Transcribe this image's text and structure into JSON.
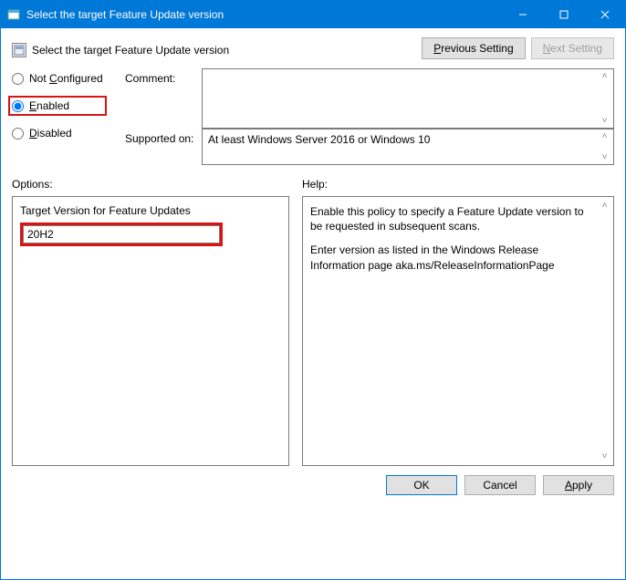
{
  "window": {
    "title": "Select the target Feature Update version"
  },
  "header": {
    "policy_name": "Select the target Feature Update version",
    "prev_label_pre": "P",
    "prev_label_post": "revious Setting",
    "next_label_pre": "N",
    "next_label_post": "ext Setting"
  },
  "radios": {
    "not_configured_pre": "Not ",
    "not_configured_u": "C",
    "not_configured_post": "onfigured",
    "enabled_u": "E",
    "enabled_post": "nabled",
    "disabled_u": "D",
    "disabled_post": "isabled",
    "selected": "enabled"
  },
  "labels": {
    "comment": "Comment:",
    "supported": "Supported on:",
    "options": "Options:",
    "help": "Help:"
  },
  "supported_text": "At least Windows Server 2016 or Windows 10",
  "option": {
    "label": "Target Version for Feature Updates",
    "value": "20H2"
  },
  "help": {
    "p1": "Enable this policy to specify a Feature Update version to be requested in subsequent scans.",
    "p2": "Enter version as listed in the Windows Release Information page aka.ms/ReleaseInformationPage"
  },
  "footer": {
    "ok": "OK",
    "cancel": "Cancel",
    "apply_u": "A",
    "apply_post": "pply"
  }
}
